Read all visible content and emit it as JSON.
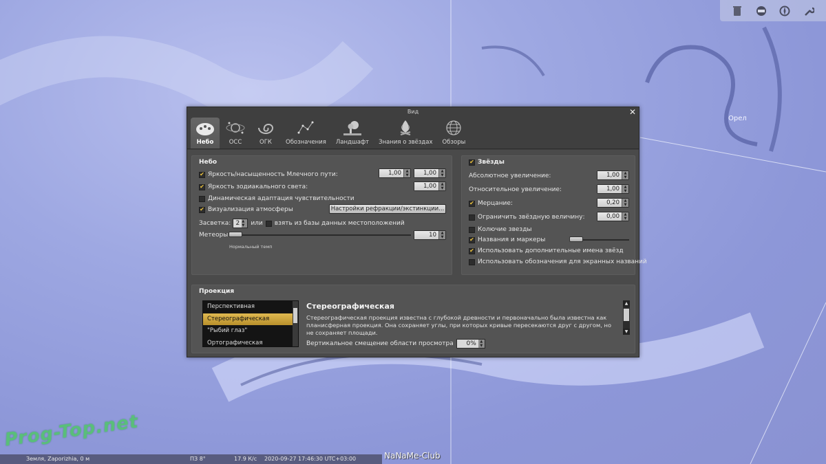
{
  "toolbar": {
    "icons": [
      "trash-icon",
      "window-icon",
      "compass-icon",
      "wrench-icon"
    ]
  },
  "sky_label": "Орел",
  "dialog": {
    "title": "Вид",
    "tabs": [
      {
        "label": "Небо",
        "icon": "sky-icon",
        "active": true
      },
      {
        "label": "ОСС",
        "icon": "solar-system-icon",
        "active": false
      },
      {
        "label": "ОГК",
        "icon": "galaxy-icon",
        "active": false
      },
      {
        "label": "Обозначения",
        "icon": "constellation-icon",
        "active": false
      },
      {
        "label": "Ландшафт",
        "icon": "landscape-icon",
        "active": false
      },
      {
        "label": "Знания о звёздах",
        "icon": "campfire-icon",
        "active": false
      },
      {
        "label": "Обзоры",
        "icon": "survey-sphere-icon",
        "active": false
      }
    ],
    "sky_panel": {
      "title": "Небо",
      "milky_way": {
        "label": "Яркость/насыщенность Млечного пути:",
        "checked": true,
        "value1": "1,00",
        "value2": "1,00"
      },
      "zodiacal": {
        "label": "Яркость зодиакального света:",
        "checked": true,
        "value": "1,00"
      },
      "adaptation": {
        "label": "Динамическая адаптация чувствительности",
        "checked": false
      },
      "atmosphere": {
        "label": "Визуализация атмосферы",
        "checked": true,
        "button": "Настройки рефракции/экстинкции..."
      },
      "light_pollution": {
        "label": "Засветка:",
        "value": "2",
        "or": "или",
        "db_label": "взять из базы данных местоположений",
        "db_checked": false
      },
      "meteors": {
        "label": "Метеоры:",
        "value": "10",
        "note": "Нормальный темп"
      }
    },
    "stars_panel": {
      "title": "Звёзды",
      "title_checked": true,
      "abs_scale": {
        "label": "Абсолютное увеличение:",
        "value": "1,00"
      },
      "rel_scale": {
        "label": "Относительное увеличение:",
        "value": "1,00"
      },
      "twinkle": {
        "label": "Мерцание:",
        "checked": true,
        "value": "0,20"
      },
      "limit_mag": {
        "label": "Ограничить звёздную величину:",
        "checked": false,
        "value": "0,00"
      },
      "spiky": {
        "label": "Колючие звезды",
        "checked": false
      },
      "names": {
        "label": "Названия и маркеры",
        "checked": true
      },
      "extra_names": {
        "label": "Использовать дополнительные имена звёзд",
        "checked": true
      },
      "screen_labels": {
        "label": "Использовать обозначения для экранных названий",
        "checked": false
      }
    },
    "projection_panel": {
      "title": "Проекция",
      "items": [
        "Перспективная",
        "Стереографическая",
        "\"Рыбий глаз\"",
        "Ортографическая"
      ],
      "selected": "Стереографическая",
      "desc_title": "Стереографическая",
      "desc_text": "Стереографическая проекция известна с глубокой древности и первоначально была известна как планисферная проекция. Она сохраняет углы, при которых кривые пересекаются друг с другом, но не сохраняет площади.",
      "offset_label": "Вертикальное смещение области просмотра",
      "offset_value": "0%"
    }
  },
  "statusbar": {
    "location": "Земля, Zaporizhia, 0 м",
    "fov": "ПЗ 8°",
    "fps": "17.9 К/с",
    "datetime": "2020-09-27  17:46:30 UTC+03:00"
  },
  "watermarks": {
    "left": "Prog-Top.net",
    "center": "NaNaMe-Club"
  },
  "colors": {
    "accent": "#f2c73c",
    "selection": "#d6ad45",
    "dialog_bg": "#3f3f3f"
  }
}
